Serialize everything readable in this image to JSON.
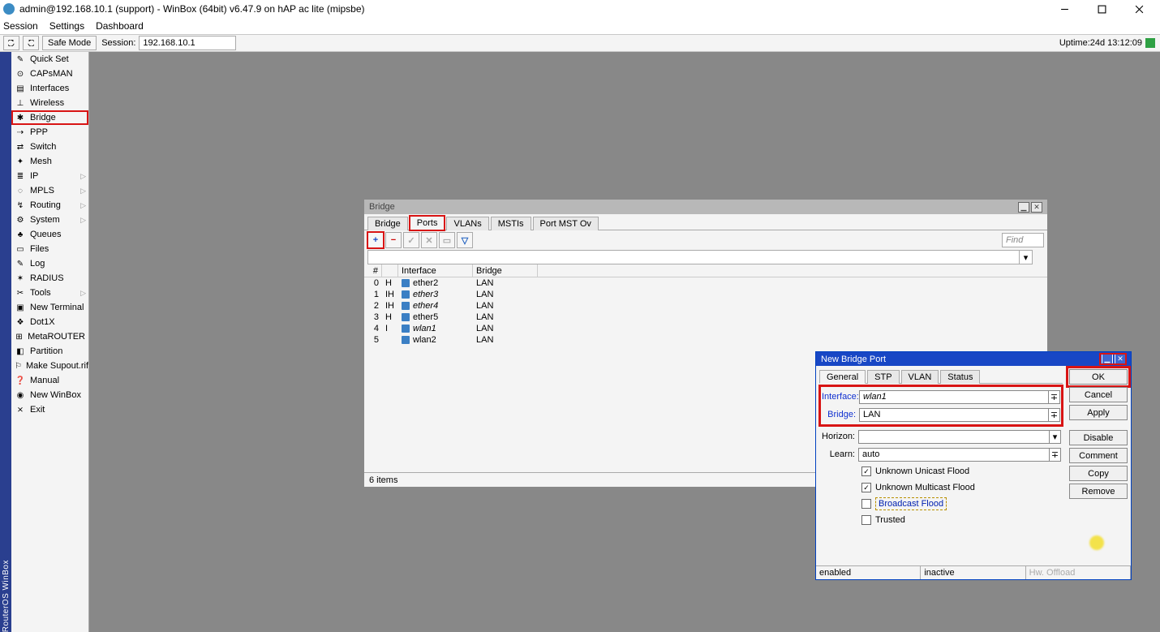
{
  "titlebar": {
    "text": "admin@192.168.10.1 (support) - WinBox (64bit) v6.47.9 on hAP ac lite (mipsbe)"
  },
  "menubar": {
    "items": [
      "Session",
      "Settings",
      "Dashboard"
    ]
  },
  "toolbar": {
    "safe_mode": "Safe Mode",
    "session_label": "Session:",
    "session_value": "192.168.10.1",
    "uptime_label": "Uptime:",
    "uptime_value": "24d 13:12:09"
  },
  "rail": {
    "text": "RouterOS WinBox"
  },
  "sidebar": {
    "items": [
      {
        "label": "Quick Set",
        "icon": "✎",
        "sub": false
      },
      {
        "label": "CAPsMAN",
        "icon": "⊙",
        "sub": false
      },
      {
        "label": "Interfaces",
        "icon": "▤",
        "sub": false
      },
      {
        "label": "Wireless",
        "icon": "⊥",
        "sub": false
      },
      {
        "label": "Bridge",
        "icon": "✱",
        "sub": false,
        "hl": true
      },
      {
        "label": "PPP",
        "icon": "⇢",
        "sub": false
      },
      {
        "label": "Switch",
        "icon": "⇄",
        "sub": false
      },
      {
        "label": "Mesh",
        "icon": "✦",
        "sub": false
      },
      {
        "label": "IP",
        "icon": "≣",
        "sub": true
      },
      {
        "label": "MPLS",
        "icon": "◌",
        "sub": true
      },
      {
        "label": "Routing",
        "icon": "↯",
        "sub": true
      },
      {
        "label": "System",
        "icon": "⚙",
        "sub": true
      },
      {
        "label": "Queues",
        "icon": "♣",
        "sub": false
      },
      {
        "label": "Files",
        "icon": "▭",
        "sub": false
      },
      {
        "label": "Log",
        "icon": "✎",
        "sub": false
      },
      {
        "label": "RADIUS",
        "icon": "✶",
        "sub": false
      },
      {
        "label": "Tools",
        "icon": "✂",
        "sub": true
      },
      {
        "label": "New Terminal",
        "icon": "▣",
        "sub": false
      },
      {
        "label": "Dot1X",
        "icon": "❖",
        "sub": false
      },
      {
        "label": "MetaROUTER",
        "icon": "⊞",
        "sub": false
      },
      {
        "label": "Partition",
        "icon": "◧",
        "sub": false
      },
      {
        "label": "Make Supout.rif",
        "icon": "⚐",
        "sub": false
      },
      {
        "label": "Manual",
        "icon": "❓",
        "sub": false
      },
      {
        "label": "New WinBox",
        "icon": "◉",
        "sub": false
      },
      {
        "label": "Exit",
        "icon": "⨯",
        "sub": false
      }
    ]
  },
  "bridge_window": {
    "title": "Bridge",
    "tabs": [
      "Bridge",
      "Ports",
      "VLANs",
      "MSTIs",
      "Port MST Ov"
    ],
    "active_tab_index": 1,
    "hl_tab_index": 1,
    "find_placeholder": "Find",
    "add_symbol": "+",
    "remove_symbol": "−",
    "columns": [
      "#",
      "",
      "Interface",
      "Bridge"
    ],
    "rows": [
      {
        "n": "0",
        "f": "H",
        "if": "ether2",
        "br": "LAN"
      },
      {
        "n": "1",
        "f": "IH",
        "if": "ether3",
        "br": "LAN",
        "it": true
      },
      {
        "n": "2",
        "f": "IH",
        "if": "ether4",
        "br": "LAN",
        "it": true
      },
      {
        "n": "3",
        "f": "H",
        "if": "ether5",
        "br": "LAN"
      },
      {
        "n": "4",
        "f": "I",
        "if": "wlan1",
        "br": "LAN",
        "it": true
      },
      {
        "n": "5",
        "f": "",
        "if": "wlan2",
        "br": "LAN"
      }
    ],
    "footer": "6 items"
  },
  "dialog": {
    "title": "New Bridge Port",
    "tabs": [
      "General",
      "STP",
      "VLAN",
      "Status"
    ],
    "active_tab_index": 0,
    "buttons": [
      "OK",
      "Cancel",
      "Apply",
      "Disable",
      "Comment",
      "Copy",
      "Remove"
    ],
    "hl_button_index": 0,
    "form": {
      "interface_label": "Interface:",
      "interface_value": "wlan1",
      "bridge_label": "Bridge:",
      "bridge_value": "LAN",
      "horizon_label": "Horizon:",
      "horizon_value": "",
      "learn_label": "Learn:",
      "learn_value": "auto",
      "unknown_unicast": "Unknown Unicast Flood",
      "unknown_multicast": "Unknown Multicast Flood",
      "broadcast_flood": "Broadcast Flood",
      "trusted": "Trusted"
    },
    "status": {
      "enabled": "enabled",
      "inactive": "inactive",
      "hw": "Hw. Offload"
    }
  }
}
